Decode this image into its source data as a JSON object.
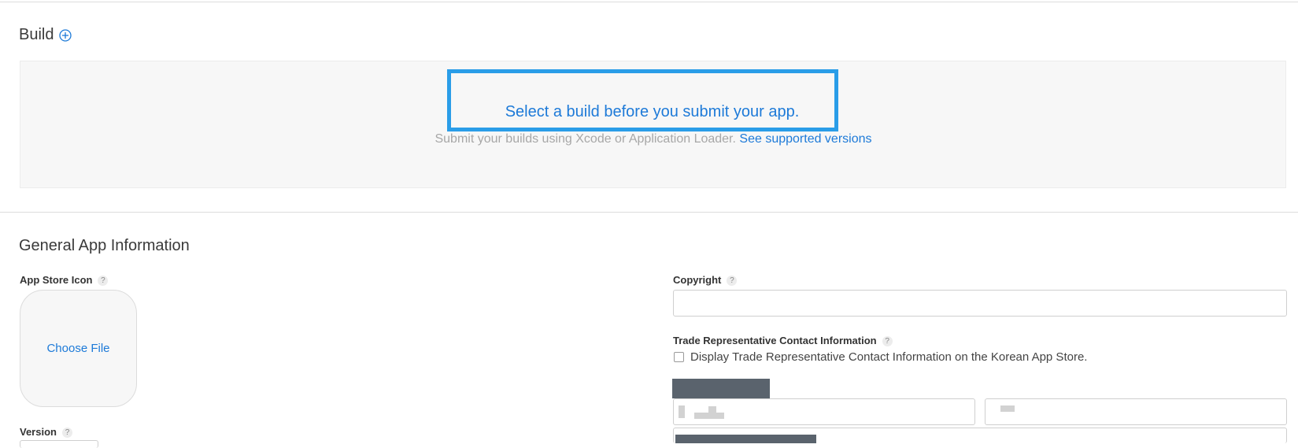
{
  "build": {
    "title": "Build",
    "add_icon": "plus-circle-icon",
    "select_message": "Select a build before you submit your app.",
    "submit_message": "Submit your builds using Xcode or Application Loader.",
    "supported_link": "See supported versions"
  },
  "general": {
    "title": "General App Information",
    "app_store_icon_label": "App Store Icon",
    "choose_file": "Choose File",
    "version_label": "Version",
    "copyright_label": "Copyright",
    "copyright_value": "",
    "trade_rep_label": "Trade Representative Contact Information",
    "trade_rep_checkbox_label": "Display Trade Representative Contact Information on the Korean App Store.",
    "trade_rep_checkbox_checked": false
  },
  "help_glyph": "?",
  "colors": {
    "link": "#1d7ad8",
    "highlight": "#2a9de8",
    "redaction": "#5a636d"
  }
}
